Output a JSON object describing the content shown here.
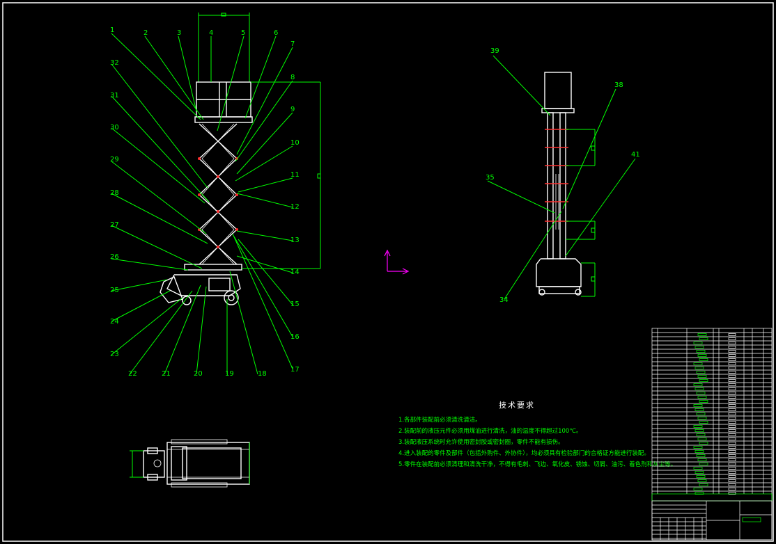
{
  "colors": {
    "background": "#000000",
    "frame": "#ffffff",
    "part": "#ffffff",
    "leader": "#00ff00",
    "axis_icon": "#ff00ff",
    "bolt_marks": "#ff3030"
  },
  "side_view": {
    "callouts": [
      "1",
      "2",
      "3",
      "4",
      "5",
      "6",
      "7",
      "8",
      "9",
      "10",
      "11",
      "12",
      "13",
      "14",
      "15",
      "16",
      "17",
      "18",
      "19",
      "20",
      "21",
      "22",
      "23",
      "24",
      "25",
      "26",
      "27",
      "28",
      "29",
      "30",
      "31",
      "32"
    ]
  },
  "end_view": {
    "callouts": [
      "39",
      "38",
      "35",
      "41",
      "34"
    ]
  },
  "technical_requirements": {
    "title": "技术要求",
    "lines": [
      "1.各部件装配前必须清洗清洁。",
      "2.装配前的液压元件必须用煤油进行清洗，油的温度不得超过100℃。",
      "3.装配液压系统时允许使用密封胶或密封圈，零件不能有损伤。",
      "4.进入装配的零件及部件（包括外购件、外协件），均必须具有检验部门的合格证方能进行装配。",
      "5.零件在装配前必须清理和清洗干净，不得有毛刺、飞边、氧化皮、锈蚀、切屑、油污、着色剂和灰尘等。"
    ]
  }
}
